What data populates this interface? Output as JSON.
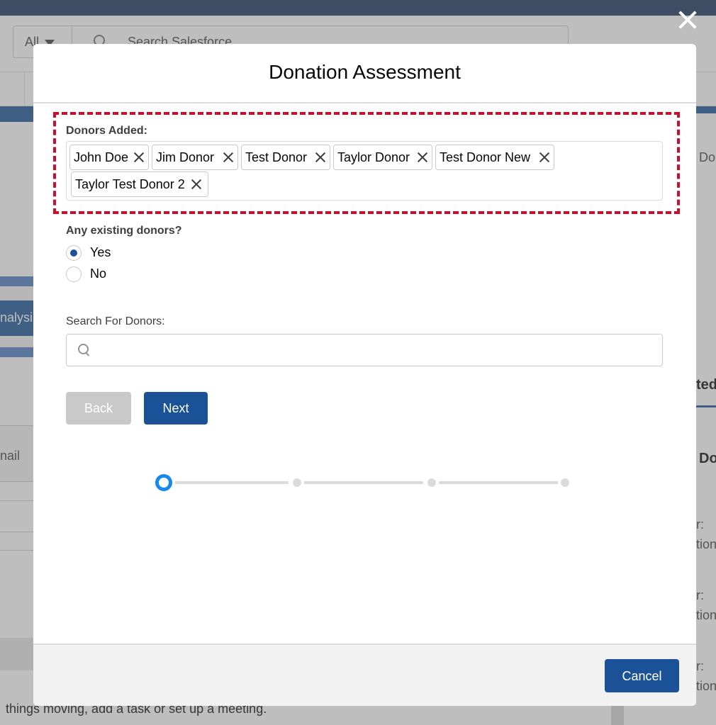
{
  "background": {
    "scope_label": "All",
    "search_placeholder": "Search Salesforce",
    "path_stage_label": "nalysi",
    "left_tab_label": "nail",
    "right_fragments": [
      "Do",
      "ted",
      "Do",
      "r:",
      "tion",
      "r:",
      "tion",
      "r:",
      "tion"
    ],
    "bottom_text": "things moving, add a task or set up a meeting."
  },
  "modal": {
    "title": "Donation Assessment",
    "donors_added_label": "Donors Added:",
    "donors": [
      "John Doe",
      "Jim Donor",
      "Test Donor",
      "Taylor Donor",
      "Test Donor New",
      "Taylor Test Donor 2"
    ],
    "existing_donors_question": "Any existing donors?",
    "options": [
      {
        "label": "Yes",
        "selected": true
      },
      {
        "label": "No",
        "selected": false
      }
    ],
    "search_label": "Search For Donors:",
    "search_value": "",
    "back_label": "Back",
    "next_label": "Next",
    "cancel_label": "Cancel",
    "progress": {
      "current_step": 1,
      "total_steps": 4
    }
  },
  "colors": {
    "brand": "#1b5297",
    "highlight": "#c8102e",
    "progress_active": "#1589ee",
    "disabled": "#c9c9c9"
  },
  "icons": {
    "close": "close-icon",
    "pill_remove": "remove-icon",
    "search": "search-icon"
  }
}
